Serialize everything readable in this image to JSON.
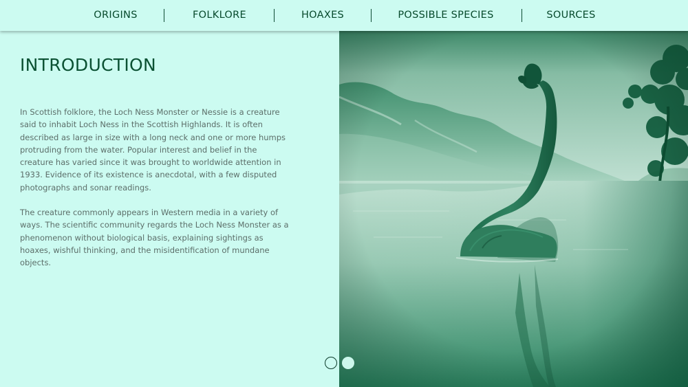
{
  "nav": {
    "items": [
      {
        "label": "ORIGINS"
      },
      {
        "label": "FOLKLORE"
      },
      {
        "label": "HOAXES"
      },
      {
        "label": "POSSIBLE SPECIES"
      },
      {
        "label": "SOURCES"
      }
    ]
  },
  "content": {
    "title": "INTRODUCTION",
    "paragraphs": [
      "In Scottish folklore, the Loch Ness Monster or Nessie is a creature said to inhabit Loch Ness in the Scottish Highlands. It is often described as large in size with a long neck and one or more humps protruding from the water. Popular interest and belief in the creature has varied since it was brought to worldwide attention in 1933. Evidence of its existence is anecdotal, with a few disputed photographs and sonar readings.",
      "The creature commonly appears in Western media in a variety of ways. The scientific community regards the Loch Ness Monster as a phenomenon without biological basis, explaining sightings as hoaxes, wishful thinking, and the misidentification of mundane objects."
    ]
  },
  "carousel": {
    "current": 1,
    "total": 2
  },
  "colors": {
    "background": "#ccfbf1",
    "nav_text": "#074a2c",
    "title": "#0b5133",
    "body_text": "#5c6e69",
    "image_tint": "#0d7a52"
  }
}
